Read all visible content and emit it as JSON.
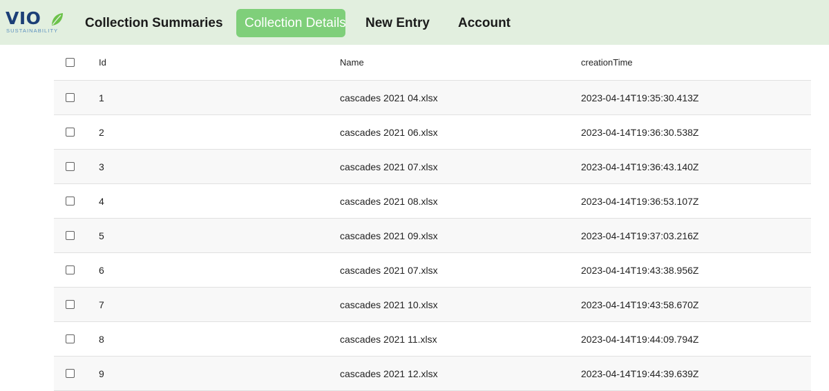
{
  "brand": {
    "name": "VIO",
    "tagline": "SUSTAINABILITY",
    "leaf_color": "#6cc24a",
    "text_color": "#1c3f77"
  },
  "nav": {
    "items": [
      {
        "label": "Collection Summaries",
        "active": false
      },
      {
        "label": "Collection Details",
        "active": true
      },
      {
        "label": "New Entry",
        "active": false
      },
      {
        "label": "Account",
        "active": false
      }
    ],
    "active_color": "#7fcf7a",
    "bar_color": "#e2efdf"
  },
  "table": {
    "columns": [
      "Id",
      "Name",
      "creationTime"
    ],
    "rows": [
      {
        "id": "1",
        "name": "cascades 2021 04.xlsx",
        "creationTime": "2023-04-14T19:35:30.413Z"
      },
      {
        "id": "2",
        "name": "cascades 2021 06.xlsx",
        "creationTime": "2023-04-14T19:36:30.538Z"
      },
      {
        "id": "3",
        "name": "cascades 2021 07.xlsx",
        "creationTime": "2023-04-14T19:36:43.140Z"
      },
      {
        "id": "4",
        "name": "cascades 2021 08.xlsx",
        "creationTime": "2023-04-14T19:36:53.107Z"
      },
      {
        "id": "5",
        "name": "cascades 2021 09.xlsx",
        "creationTime": "2023-04-14T19:37:03.216Z"
      },
      {
        "id": "6",
        "name": "cascades 2021 07.xlsx",
        "creationTime": "2023-04-14T19:43:38.956Z"
      },
      {
        "id": "7",
        "name": "cascades 2021 10.xlsx",
        "creationTime": "2023-04-14T19:43:58.670Z"
      },
      {
        "id": "8",
        "name": "cascades 2021 11.xlsx",
        "creationTime": "2023-04-14T19:44:09.794Z"
      },
      {
        "id": "9",
        "name": "cascades 2021 12.xlsx",
        "creationTime": "2023-04-14T19:44:39.639Z"
      }
    ]
  }
}
